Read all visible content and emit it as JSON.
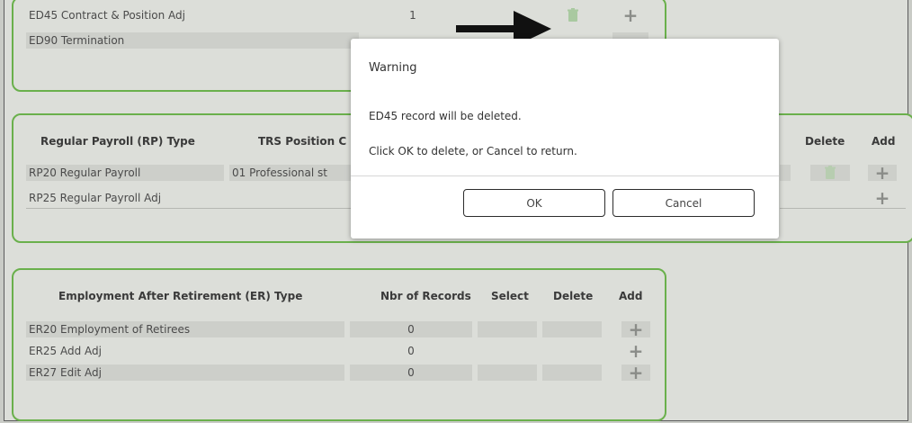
{
  "colors": {
    "panel_border": "#6ab04c",
    "background": "#dcded9",
    "arrow": "#111111"
  },
  "ed_panel": {
    "rows": [
      {
        "label": "ED45 Contract & Position Adj",
        "records": "1"
      },
      {
        "label": "ED90 Termination"
      }
    ]
  },
  "rp_panel": {
    "headers": {
      "type": "Regular Payroll (RP) Type",
      "trs": "TRS Position C",
      "delete": "Delete",
      "add": "Add"
    },
    "rows": [
      {
        "label": "RP20 Regular Payroll",
        "trs": "01 Professional st"
      },
      {
        "label": "RP25 Regular Payroll Adj"
      }
    ]
  },
  "er_panel": {
    "headers": {
      "type": "Employment After Retirement (ER) Type",
      "records": "Nbr of Records",
      "select": "Select",
      "delete": "Delete",
      "add": "Add"
    },
    "rows": [
      {
        "label": "ER20 Employment of Retirees",
        "records": "0"
      },
      {
        "label": "ER25 Add Adj",
        "records": "0"
      },
      {
        "label": "ER27 Edit Adj",
        "records": "0"
      }
    ]
  },
  "dialog": {
    "title": "Warning",
    "message": "ED45 record will be deleted.",
    "instruction": "Click OK to delete, or Cancel to return.",
    "ok_label": "OK",
    "cancel_label": "Cancel"
  },
  "icons": {
    "add": "plus-icon",
    "delete": "trash-icon",
    "pointer": "arrow-icon"
  }
}
